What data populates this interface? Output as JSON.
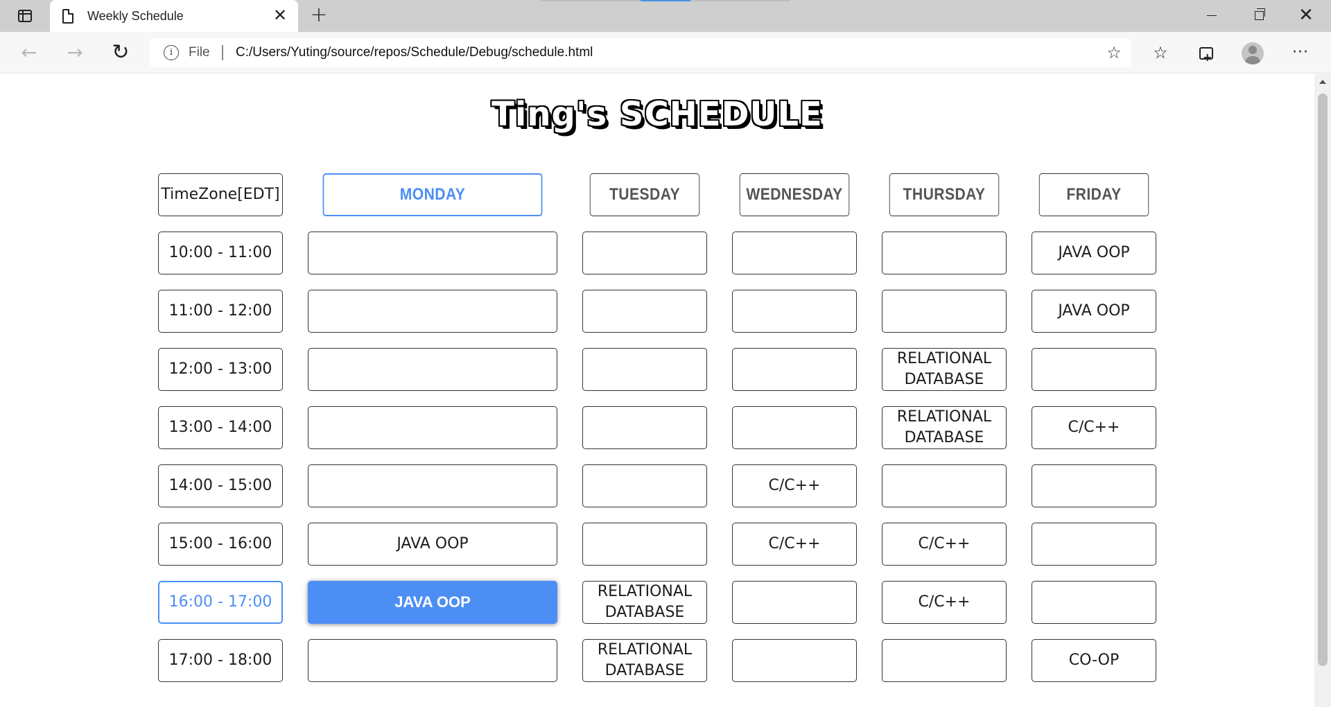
{
  "browser": {
    "tab_title": "Weekly Schedule",
    "tab_close": "✕",
    "new_tab": "+",
    "scheme": "File",
    "url": "C:/Users/Yuting/source/repos/Schedule/Debug/schedule.html",
    "accent_color": "#4d8ef5"
  },
  "page": {
    "title": "Ting's SCHEDULE"
  },
  "schedule": {
    "timezone_label": "TimeZone[EDT]",
    "days": [
      "MONDAY",
      "TUESDAY",
      "WEDNESDAY",
      "THURSDAY",
      "FRIDAY"
    ],
    "times": [
      "10:00 - 11:00",
      "11:00 - 12:00",
      "12:00 - 13:00",
      "13:00 - 14:00",
      "14:00 - 15:00",
      "15:00 - 16:00",
      "16:00 - 17:00",
      "17:00 - 18:00"
    ],
    "cells": [
      [
        "",
        "",
        "",
        "",
        "JAVA OOP"
      ],
      [
        "",
        "",
        "",
        "",
        "JAVA OOP"
      ],
      [
        "",
        "",
        "",
        "RELATIONAL\nDATABASE",
        ""
      ],
      [
        "",
        "",
        "",
        "RELATIONAL\nDATABASE",
        "C/C++"
      ],
      [
        "",
        "",
        "C/C++",
        "",
        ""
      ],
      [
        "JAVA OOP",
        "",
        "C/C++",
        "C/C++",
        ""
      ],
      [
        "JAVA OOP",
        "RELATIONAL\nDATABASE",
        "",
        "C/C++",
        ""
      ],
      [
        "",
        "RELATIONAL\nDATABASE",
        "",
        "",
        "CO-OP"
      ]
    ],
    "highlighted_day": "MONDAY",
    "highlighted_time": "16:00 - 17:00",
    "selected_cell": "MONDAY 16:00 - 17:00"
  }
}
